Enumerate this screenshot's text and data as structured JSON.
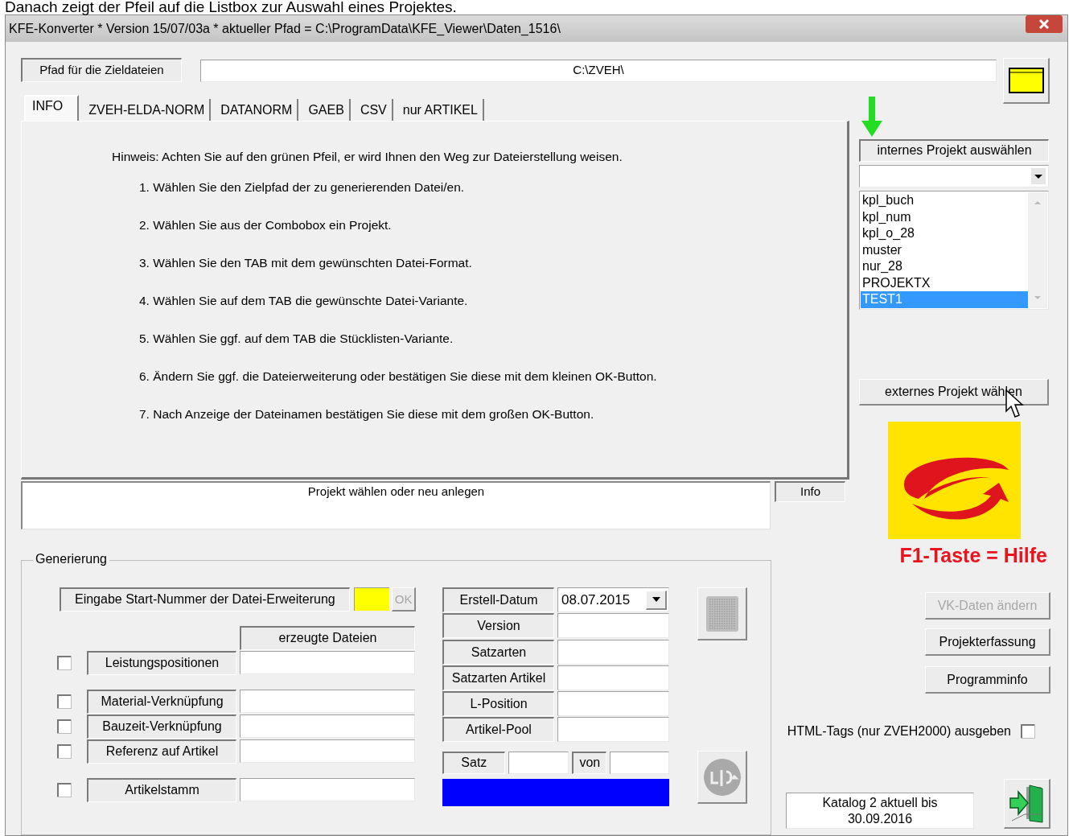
{
  "caption": "Danach zeigt der Pfeil auf die Listbox zur Auswahl eines Projektes.",
  "window": {
    "title": "KFE-Konverter * Version 15/07/03a * aktueller Pfad = C:\\ProgramData\\KFE_Viewer\\Daten_1516\\"
  },
  "target_path": {
    "label": "Pfad für die Zieldateien",
    "value": "C:\\ZVEH\\"
  },
  "tabs": [
    {
      "label": "INFO",
      "selected": true
    },
    {
      "label": "ZVEH-ELDA-NORM",
      "selected": false
    },
    {
      "label": "DATANORM",
      "selected": false
    },
    {
      "label": "GAEB",
      "selected": false
    },
    {
      "label": "CSV",
      "selected": false
    },
    {
      "label": "nur ARTIKEL",
      "selected": false
    }
  ],
  "info": {
    "hint": "Hinweis: Achten Sie auf den grünen Pfeil, er wird Ihnen den Weg zur Dateierstellung weisen.",
    "steps": [
      "1. Wählen Sie den Zielpfad der zu generierenden Datei/en.",
      "2. Wählen Sie aus der Combobox ein Projekt.",
      "3. Wählen Sie den TAB mit dem gewünschten Datei-Format.",
      "4. Wählen Sie auf dem TAB die gewünschte Datei-Variante.",
      "5. Wählen Sie ggf. auf dem TAB die Stücklisten-Variante.",
      "6. Ändern Sie ggf. die Dateierweiterung oder bestätigen Sie diese mit dem kleinen OK-Button.",
      "7. Nach Anzeige der Dateinamen bestätigen Sie diese mit dem großen OK-Button."
    ]
  },
  "status": {
    "message": "Projekt wählen oder neu anlegen",
    "info_label": "Info"
  },
  "projects": {
    "label": "internes Projekt auswählen",
    "items": [
      {
        "label": "kpl_buch",
        "selected": false
      },
      {
        "label": "kpl_num",
        "selected": false
      },
      {
        "label": "kpl_o_28",
        "selected": false
      },
      {
        "label": "muster",
        "selected": false
      },
      {
        "label": "nur_28",
        "selected": false
      },
      {
        "label": "PROJEKTX",
        "selected": false
      },
      {
        "label": "TEST1",
        "selected": true
      }
    ]
  },
  "external_button": "externes Projekt wählen",
  "generation": {
    "title": "Generierung",
    "start_number": {
      "label": "Eingabe Start-Nummer der Datei-Erweiterung",
      "ok": {
        "label": "OK",
        "disabled": true
      }
    },
    "files_header": "erzeugte Dateien",
    "output_groups": [
      {
        "items": [
          {
            "label": "Leistungspositionen",
            "checked": false
          }
        ]
      },
      {
        "items": [
          {
            "label": "Material-Verknüpfung",
            "checked": false
          },
          {
            "label": "Bauzeit-Verknüpfung",
            "checked": false
          },
          {
            "label": "Referenz auf Artikel",
            "checked": false
          }
        ]
      },
      {
        "items": [
          {
            "label": "Artikelstamm",
            "checked": false
          }
        ]
      }
    ],
    "details": [
      {
        "label": "Erstell-Datum",
        "kind": "date",
        "value": "08.07.2015"
      },
      {
        "label": "Version",
        "kind": "text"
      },
      {
        "label": "Satzarten",
        "kind": "text"
      },
      {
        "label": "Satzarten Artikel",
        "kind": "text"
      },
      {
        "label": "L-Position",
        "kind": "text"
      },
      {
        "label": "Artikel-Pool",
        "kind": "text"
      }
    ],
    "record": {
      "label": "Satz",
      "of_label": "von"
    }
  },
  "help": "F1-Taste = Hilfe",
  "buttons": [
    {
      "label": "VK-Daten ändern",
      "disabled": true
    },
    {
      "label": "Projekterfassung",
      "disabled": false
    },
    {
      "label": "Programminfo",
      "disabled": false
    }
  ],
  "html_tags": {
    "label": "HTML-Tags (nur ZVEH2000) ausgeben",
    "checked": false
  },
  "catalog": "Katalog 2 aktuell bis\n30.09.2016"
}
